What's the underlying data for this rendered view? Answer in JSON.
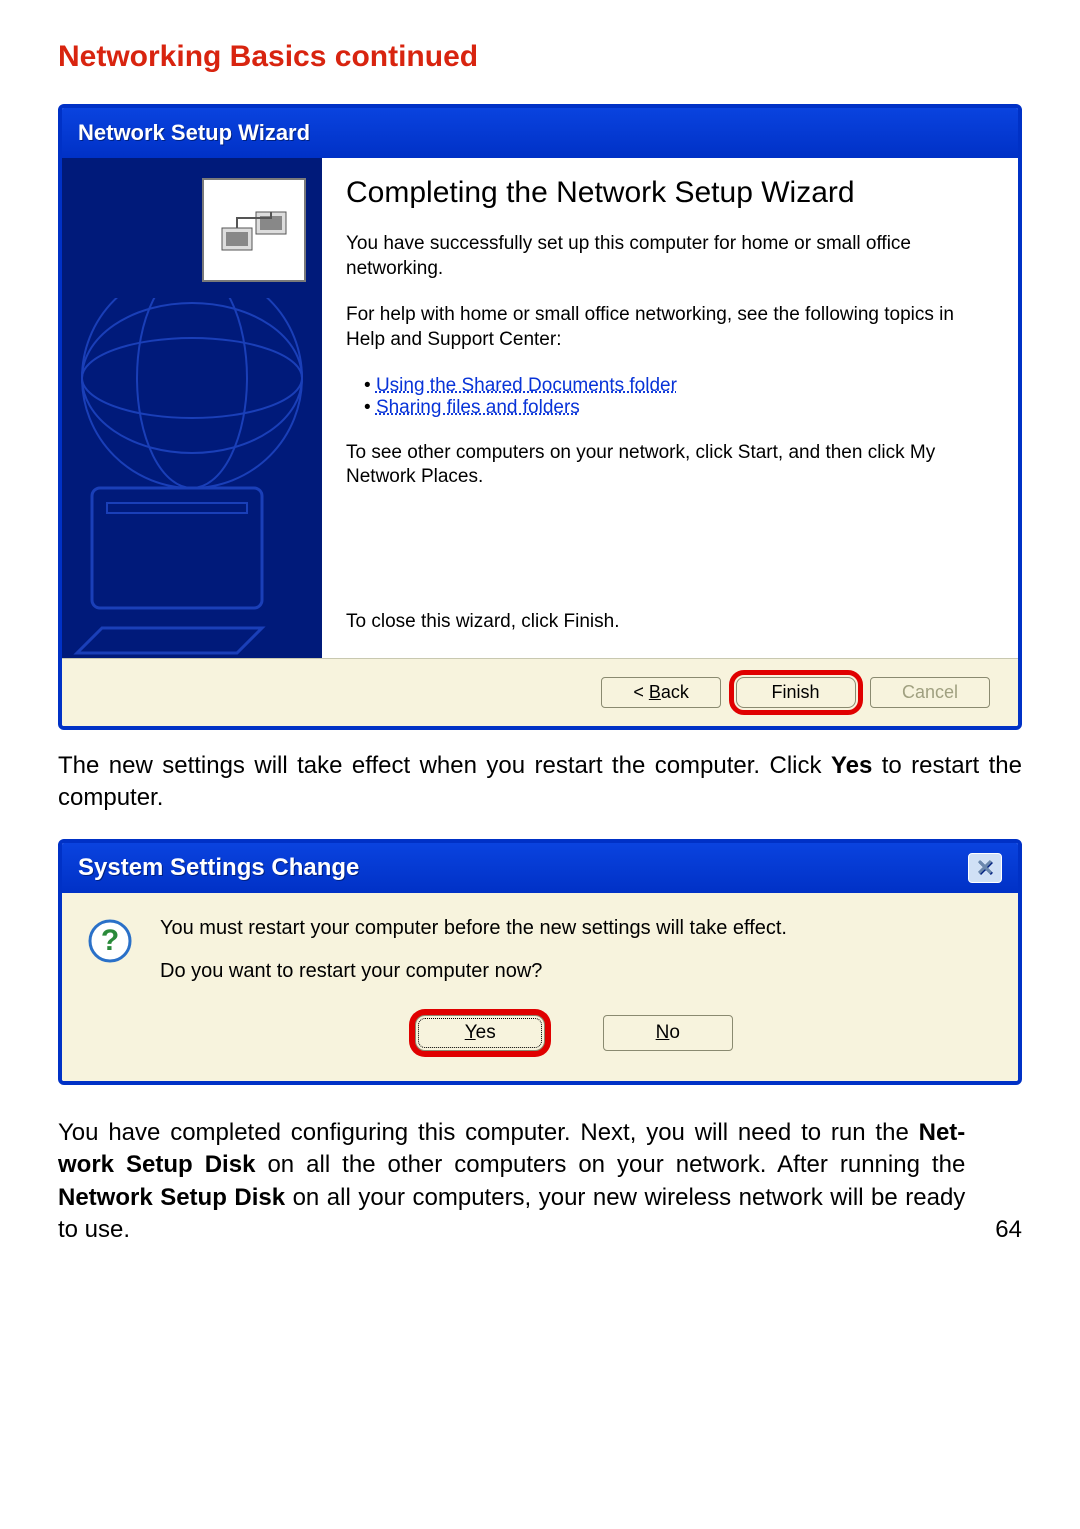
{
  "page": {
    "title": "Networking Basics   continued",
    "number": "64"
  },
  "wizard": {
    "title": "Network Setup Wizard",
    "heading": "Completing the Network Setup Wizard",
    "p1": "You have successfully set up this computer for home or small office networking.",
    "p2": "For help with home or small office networking, see the following topics in Help and Support Center:",
    "links": {
      "shared_docs": "Using the Shared Documents folder",
      "sharing": "Sharing files and folders"
    },
    "p3": "To see other computers on your network, click Start, and then click My Network Places.",
    "close_text": "To close this wizard, click Finish.",
    "buttons": {
      "back_prefix": "< ",
      "back_u": "B",
      "back_suffix": "ack",
      "finish": "Finish",
      "cancel": "Cancel"
    }
  },
  "body_text_1_a": "The new settings will take effect when you restart the computer.  Click ",
  "body_text_1_bold": "Yes",
  "body_text_1_b": " to restart the computer.",
  "dialog": {
    "title": "System Settings Change",
    "line1": "You must restart your computer before the new settings will take effect.",
    "line2": "Do you want to restart your computer now?",
    "buttons": {
      "yes_u": "Y",
      "yes_suffix": "es",
      "no_u": "N",
      "no_suffix": "o"
    }
  },
  "body_text_2_a": "You have completed configuring this computer.  Next, you will need to run the ",
  "body_text_2_bold1": "Net-work Setup Disk",
  "body_text_2_b": " on all the other computers on your network.  After running the ",
  "body_text_2_bold2": "Network Setup Disk",
  "body_text_2_c": " on all your computers, your new wireless network will be ready to use."
}
